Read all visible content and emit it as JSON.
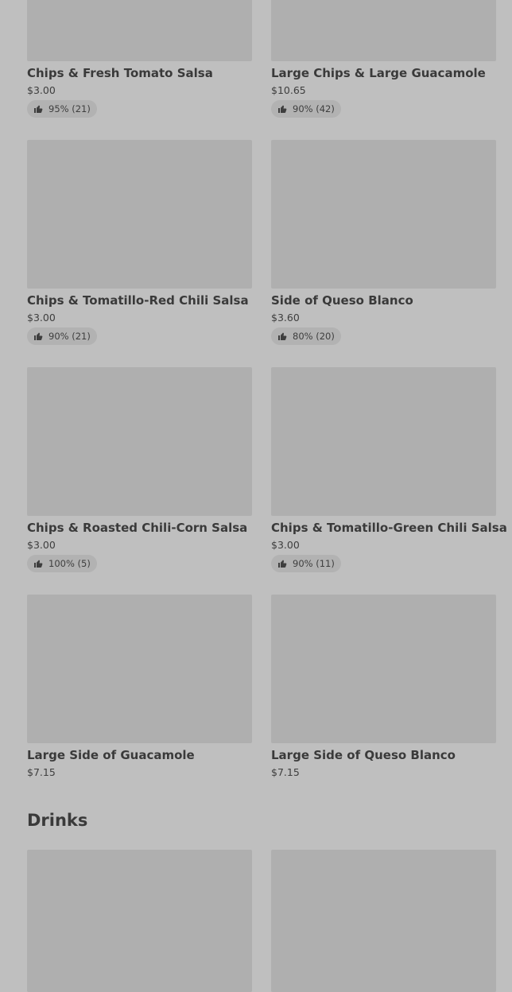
{
  "items": [
    {
      "title": "Chips & Fresh Tomato Salsa",
      "price": "$3.00",
      "rating": "95% (21)"
    },
    {
      "title": "Large Chips & Large Guacamole",
      "price": "$10.65",
      "rating": "90% (42)"
    },
    {
      "title": "Chips & Tomatillo-Red Chili Salsa",
      "price": "$3.00",
      "rating": "90% (21)"
    },
    {
      "title": "Side of Queso Blanco",
      "price": "$3.60",
      "rating": "80% (20)"
    },
    {
      "title": "Chips & Roasted Chili-Corn Salsa",
      "price": "$3.00",
      "rating": "100% (5)"
    },
    {
      "title": "Chips & Tomatillo-Green Chili Salsa",
      "price": "$3.00",
      "rating": "90% (11)"
    },
    {
      "title": "Large Side of Guacamole",
      "price": "$7.15"
    },
    {
      "title": "Large Side of Queso Blanco",
      "price": "$7.15"
    }
  ],
  "section": {
    "drinks_title": "Drinks"
  },
  "icons": {
    "rating": "thumbs-up-icon"
  },
  "colors": {
    "background": "#bfbfbf",
    "image_placeholder": "#afafaf",
    "text": "#3b3b3b"
  }
}
